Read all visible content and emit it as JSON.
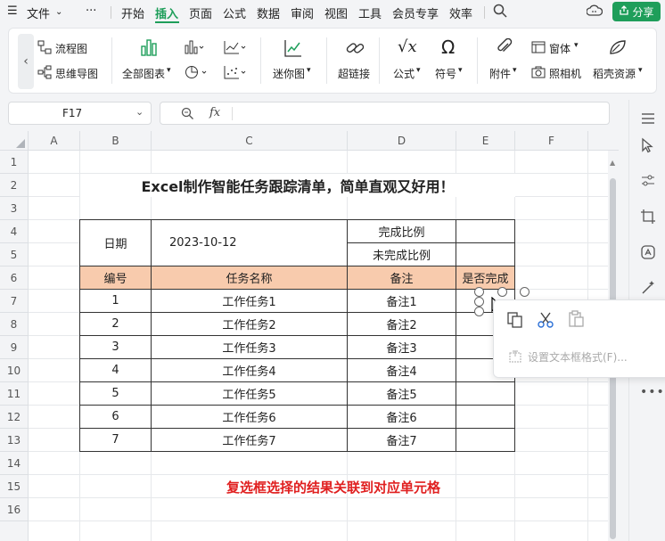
{
  "menubar": {
    "file_label": "文件",
    "more_label": "···",
    "tabs": [
      "开始",
      "插入",
      "页面",
      "公式",
      "数据",
      "审阅",
      "视图",
      "工具",
      "会员专享",
      "效率"
    ],
    "active_tab": "插入",
    "share_label": "分享"
  },
  "ribbon": {
    "flowchart": "流程图",
    "mindmap": "思维导图",
    "all_charts": "全部图表",
    "sparkline": "迷你图",
    "hyperlink": "超链接",
    "formula": "公式",
    "symbol": "符号",
    "attachment": "附件",
    "form": "窗体",
    "camera": "照相机",
    "resources": "稻壳资源"
  },
  "formula_bar": {
    "name_box": "F17",
    "fx": "fx",
    "value": ""
  },
  "sheet": {
    "columns": [
      "A",
      "B",
      "C",
      "D",
      "E",
      "F"
    ],
    "rows": [
      "1",
      "2",
      "3",
      "4",
      "5",
      "6",
      "7",
      "8",
      "9",
      "10",
      "11",
      "12",
      "13",
      "14",
      "15",
      "16"
    ],
    "title": "Excel制作智能任务跟踪清单，简单直观又好用！",
    "date_label": "日期",
    "date_value": "2023-10-12",
    "complete_ratio": "完成比例",
    "incomplete_ratio": "未完成比例",
    "headers": [
      "编号",
      "任务名称",
      "备注",
      "是否完成"
    ],
    "tasks": [
      {
        "no": "1",
        "name": "工作任务1",
        "note": "备注1"
      },
      {
        "no": "2",
        "name": "工作任务2",
        "note": "备注2"
      },
      {
        "no": "3",
        "name": "工作任务3",
        "note": "备注3"
      },
      {
        "no": "4",
        "name": "工作任务4",
        "note": "备注4"
      },
      {
        "no": "5",
        "name": "工作任务5",
        "note": "备注5"
      },
      {
        "no": "6",
        "name": "工作任务6",
        "note": "备注6"
      },
      {
        "no": "7",
        "name": "工作任务7",
        "note": "备注7"
      }
    ],
    "footer_note": "复选框选择的结果关联到对应单元格"
  },
  "popup": {
    "set_format": "设置文本框格式(F)..."
  },
  "colors": {
    "accent": "#1e9e5a",
    "header_fill": "#f8cbad",
    "footer_text": "#e02020"
  }
}
